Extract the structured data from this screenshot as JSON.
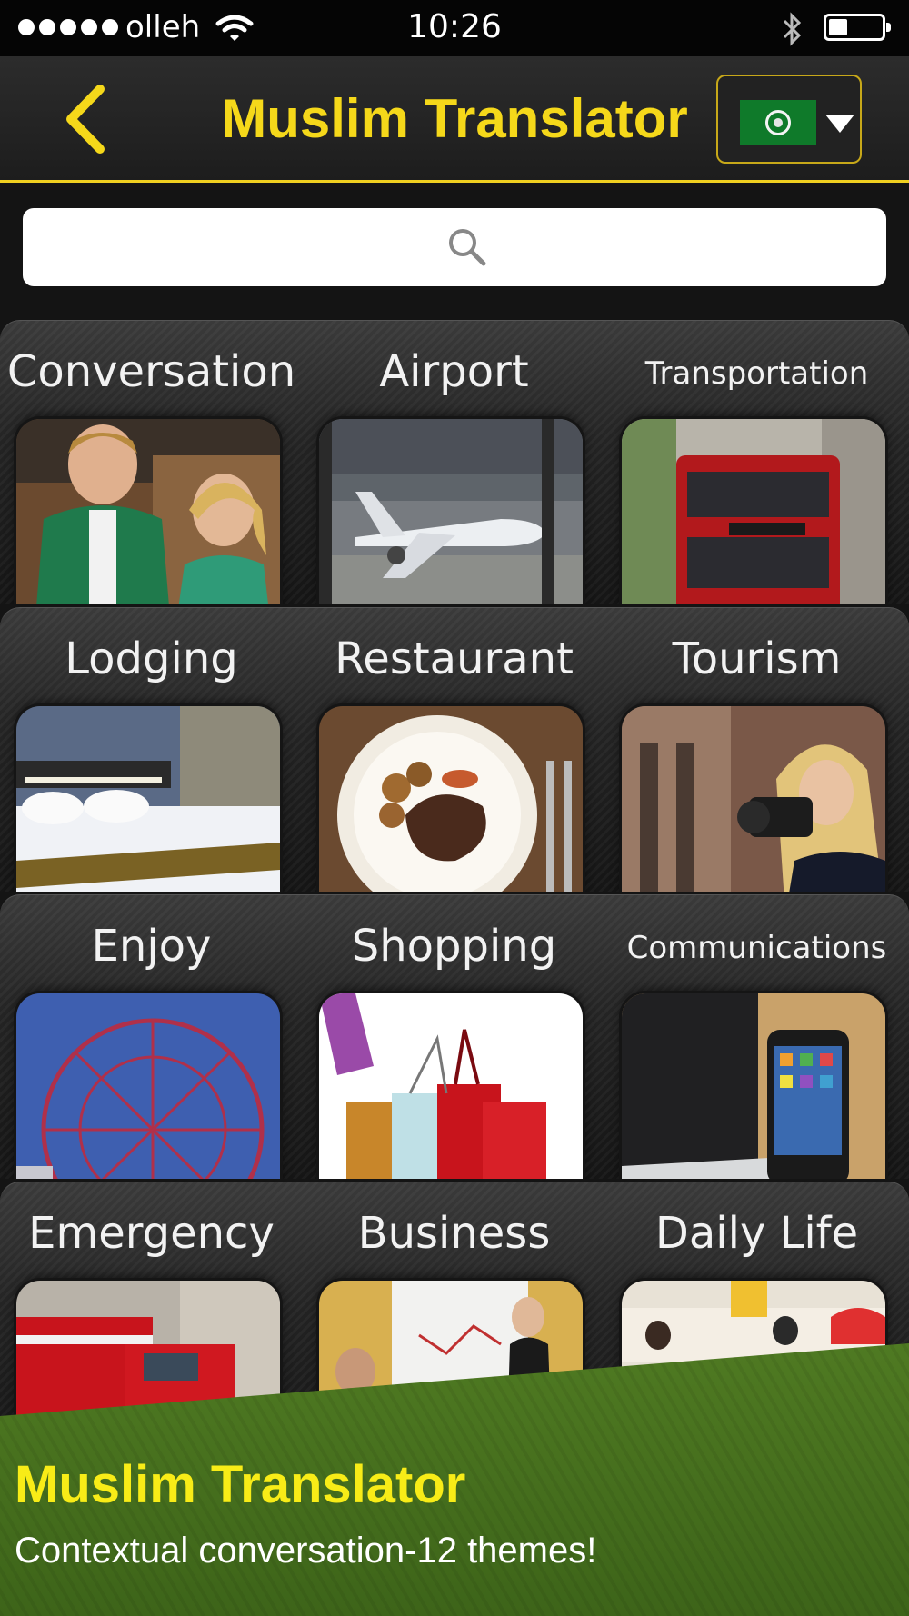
{
  "status_bar": {
    "carrier": "olleh",
    "time": "10:26",
    "signal_bars": 5,
    "battery_level": 0.35
  },
  "nav": {
    "title": "Muslim Translator",
    "back_icon": "chevron-left-icon",
    "language_flag": "arab-league-flag-icon",
    "accent_color": "#f5d81a"
  },
  "search": {
    "placeholder": "",
    "icon": "search-icon"
  },
  "themes": [
    {
      "label": "Conversation",
      "image": "two-people-talking"
    },
    {
      "label": "Airport",
      "image": "airplane-at-gate"
    },
    {
      "label": "Transportation",
      "image": "red-double-decker-bus"
    },
    {
      "label": "Lodging",
      "image": "hotel-bed"
    },
    {
      "label": "Restaurant",
      "image": "steak-dinner-plate"
    },
    {
      "label": "Tourism",
      "image": "woman-with-camera"
    },
    {
      "label": "Enjoy",
      "image": "ferris-wheel"
    },
    {
      "label": "Shopping",
      "image": "shopping-bags"
    },
    {
      "label": "Communications",
      "image": "smartphone-and-laptop"
    },
    {
      "label": "Emergency",
      "image": "ambulance"
    },
    {
      "label": "Business",
      "image": "presentation-meeting"
    },
    {
      "label": "Daily Life",
      "image": "street-shops"
    }
  ],
  "promo": {
    "title": "Muslim Translator",
    "subtitle": "Contextual conversation-12 themes!",
    "background_color": "#4a7320"
  }
}
